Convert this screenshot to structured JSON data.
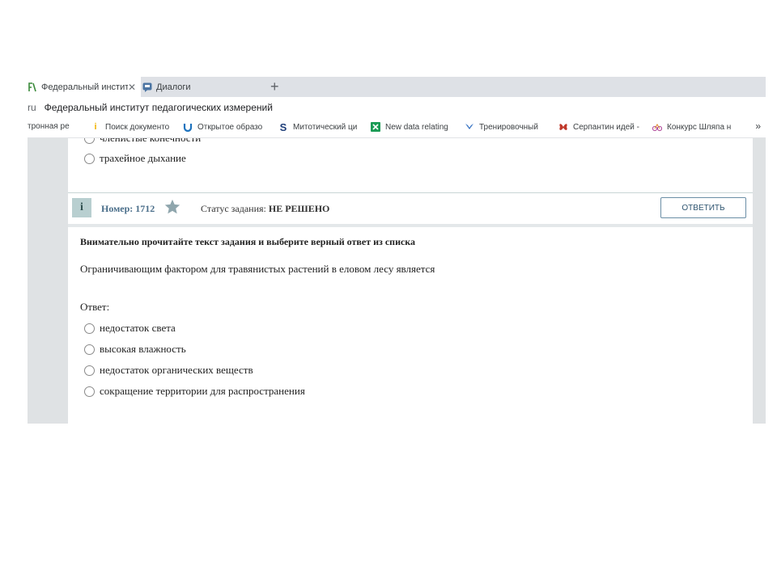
{
  "tabs": [
    {
      "label": "Федеральный институт",
      "icon": "fipi-icon",
      "active": true
    },
    {
      "label": "Диалоги",
      "icon": "dialogs-icon",
      "active": false
    }
  ],
  "new_tab": "+",
  "address": {
    "scheme": "ru",
    "text": "Федеральный институт педагогических измерений"
  },
  "bookmarks": [
    {
      "label": "тронная ре",
      "icon": ""
    },
    {
      "label": "Поиск документо",
      "icon": "i"
    },
    {
      "label": "Открытое образо",
      "icon": "U"
    },
    {
      "label": "Митотический ци",
      "icon": "S"
    },
    {
      "label": "New data relating",
      "icon": "x"
    },
    {
      "label": "Тренировочный",
      "icon": "v"
    },
    {
      "label": "Серпантин идей -",
      "icon": "butterfly"
    },
    {
      "label": "Конкурс Шляпа н",
      "icon": "bike"
    }
  ],
  "bookmarks_more": "»",
  "prev_options": [
    "членистые конечности",
    "трахейное дыхание"
  ],
  "task": {
    "number_label": "Номер: 1712",
    "status_label": "Статус задания: ",
    "status_value": "НЕ РЕШЕНО",
    "answer_button": "ОТВЕТИТЬ",
    "info_icon": "i"
  },
  "instruction": "Внимательно прочитайте текст задания и выберите верный ответ из списка",
  "question": "Ограничивающим фактором для травянистых растений в еловом лесу является",
  "answer_label": "Ответ:",
  "options": [
    "недостаток света",
    "высокая влажность",
    "недостаток органических веществ",
    "сокращение территории для распространения"
  ],
  "colors": {
    "page_bg": "#dfe2e4",
    "info_badge": "#b8cfd0",
    "button_border": "#6b8ea6"
  }
}
